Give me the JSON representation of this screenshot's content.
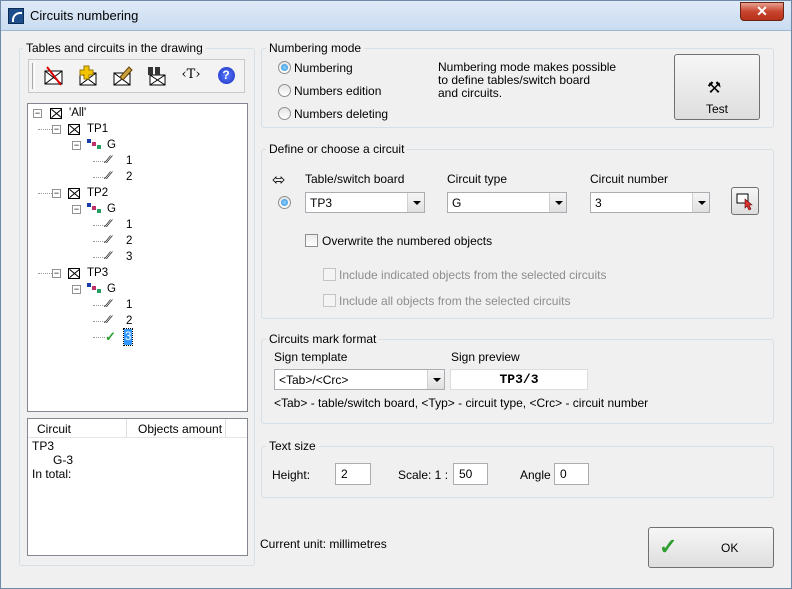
{
  "window": {
    "title": "Circuits numbering",
    "close_label": "✕"
  },
  "left": {
    "title": "Tables and circuits in the drawing",
    "toolbar": [
      {
        "icon": "delete-x-icon",
        "glyph": "✗"
      },
      {
        "icon": "add-icon",
        "glyph": "✚"
      },
      {
        "icon": "edit-icon",
        "glyph": "✎"
      },
      {
        "icon": "binoculars-icon",
        "glyph": "⌕"
      },
      {
        "icon": "text-tag-icon",
        "glyph": "‹T›"
      },
      {
        "icon": "help-icon",
        "glyph": "?"
      }
    ],
    "tree": {
      "root": "'All'",
      "boards": [
        {
          "name": "TP1",
          "group": "G",
          "circuits": [
            "1",
            "2"
          ]
        },
        {
          "name": "TP2",
          "group": "G",
          "circuits": [
            "1",
            "2",
            "3"
          ]
        },
        {
          "name": "TP3",
          "group": "G",
          "circuits": [
            "1",
            "2",
            "3"
          ]
        }
      ]
    },
    "table": {
      "col1": "Circuit",
      "col2": "Objects amount",
      "row1": "TP3",
      "row2": "G-3",
      "row3": "In total:"
    }
  },
  "numbering_mode": {
    "title": "Numbering mode",
    "opt1": "Numbering",
    "opt2": "Numbers edition",
    "opt3": "Numbers deleting",
    "desc1": "Numbering mode makes possible",
    "desc2": "to define tables/switch board",
    "desc3": "and circuits.",
    "test_label": "Test"
  },
  "define": {
    "title": "Define or choose a circuit",
    "table_label": "Table/switch board",
    "table_value": "TP3",
    "type_label": "Circuit type",
    "type_value": "G",
    "number_label": "Circuit number",
    "number_value": "3",
    "overwrite": "Overwrite the numbered objects",
    "include_indicated": "Include indicated objects from the selected circuits",
    "include_all": "Include all objects from the selected circuits"
  },
  "mark": {
    "title": "Circuits mark format",
    "template_label": "Sign template",
    "template_value": "<Tab>/<Crc>",
    "preview_label": "Sign preview",
    "preview_value": "TP3/3",
    "legend": "<Tab> - table/switch board, <Typ> - circuit type, <Crc> - circuit number"
  },
  "text_size": {
    "title": "Text size",
    "height_label": "Height:",
    "height_value": "2",
    "scale_label": "Scale: 1 :",
    "scale_value": "50",
    "angle_label": "Angle",
    "angle_value": "0"
  },
  "footer": {
    "unit": "Current unit: millimetres",
    "ok_label": "OK"
  },
  "colors": {
    "accent": "#2a8ad4",
    "check": "#2e9e2e",
    "selected": "#3399ff"
  }
}
